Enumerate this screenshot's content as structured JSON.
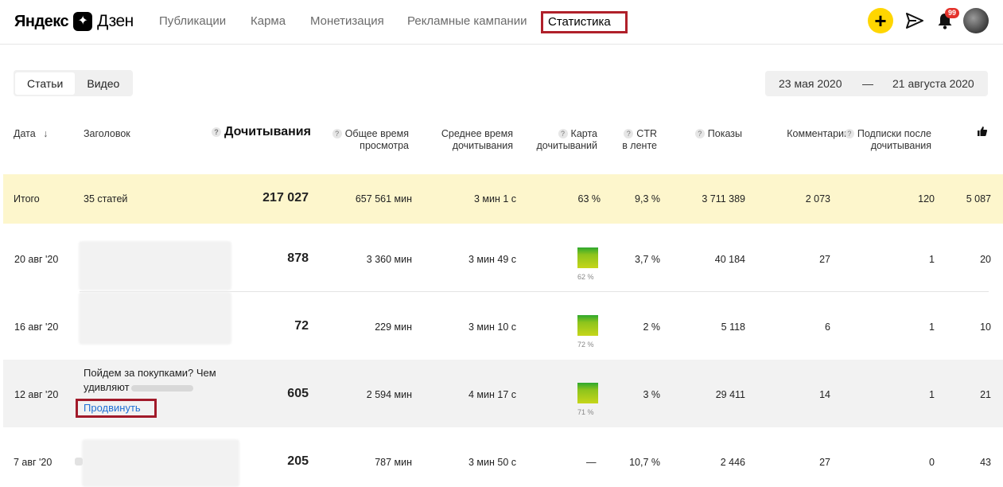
{
  "header": {
    "logo_left": "Яндекс",
    "logo_right": "Дзен",
    "nav": [
      "Публикации",
      "Карма",
      "Монетизация",
      "Рекламные кампании",
      "Статистика"
    ],
    "notifications_count": "99"
  },
  "toolbar": {
    "tabs": [
      "Статьи",
      "Видео"
    ],
    "date_from": "23 мая 2020",
    "date_dash": "—",
    "date_to": "21 августа 2020"
  },
  "columns": {
    "date": "Дата",
    "title": "Заголовок",
    "reads": "Дочитывания",
    "total_time_1": "Общее время",
    "total_time_2": "просмотра",
    "avg_time_1": "Среднее время",
    "avg_time_2": "дочитывания",
    "map_1": "Карта",
    "map_2": "дочитываний",
    "ctr_1": "CTR",
    "ctr_2": "в ленте",
    "shows": "Показы",
    "comments": "Комментарии",
    "subs_1": "Подписки после",
    "subs_2": "дочитывания"
  },
  "total": {
    "label": "Итого",
    "articles": "35 статей",
    "reads": "217 027",
    "total_time": "657 561 мин",
    "avg_time": "3 мин 1 с",
    "map": "63 %",
    "ctr": "9,3 %",
    "shows": "3 711 389",
    "comments": "2 073",
    "subs": "120",
    "likes": "5 087"
  },
  "rows": [
    {
      "date": "20 авг '20",
      "reads": "878",
      "total_time": "3 360 мин",
      "avg_time": "3 мин 49 с",
      "map_pct": "62 %",
      "ctr": "3,7 %",
      "shows": "40 184",
      "comments": "27",
      "subs": "1",
      "likes": "20"
    },
    {
      "date": "16 авг '20",
      "reads": "72",
      "total_time": "229 мин",
      "avg_time": "3 мин 10 с",
      "map_pct": "72 %",
      "ctr": "2 %",
      "shows": "5 118",
      "comments": "6",
      "subs": "1",
      "likes": "10"
    },
    {
      "date": "12 авг '20",
      "title": "Пойдем за покупками? Чем удивляют",
      "promote": "Продвинуть",
      "reads": "605",
      "total_time": "2 594 мин",
      "avg_time": "4 мин 17 с",
      "map_pct": "71 %",
      "ctr": "3 %",
      "shows": "29 411",
      "comments": "14",
      "subs": "1",
      "likes": "21"
    },
    {
      "date": "7 авг '20",
      "reads": "205",
      "total_time": "787 мин",
      "avg_time": "3 мин 50 с",
      "map_dash": "—",
      "ctr": "10,7 %",
      "shows": "2 446",
      "comments": "27",
      "subs": "0",
      "likes": "43"
    }
  ]
}
